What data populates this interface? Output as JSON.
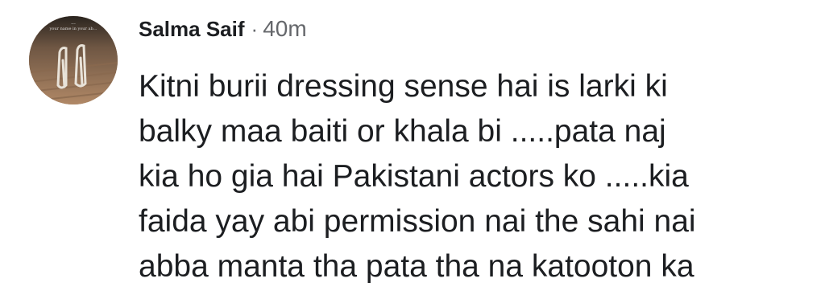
{
  "comment": {
    "author": "Salma Saif",
    "separator": "·",
    "time": "40m",
    "avatar": {
      "icon": "profile-photo",
      "overlay_text_line1": "...",
      "overlay_text_line2": "your name in your ab..."
    },
    "lines": [
      "Kitni burii dressing sense hai is larki ki",
      "balky maa baiti or khala bi .....pata naj",
      "kia ho gia hai Pakistani actors ko .....kia",
      "faida yay abi permission nai the sahi nai",
      "abba manta tha pata tha na katooton ka"
    ]
  }
}
